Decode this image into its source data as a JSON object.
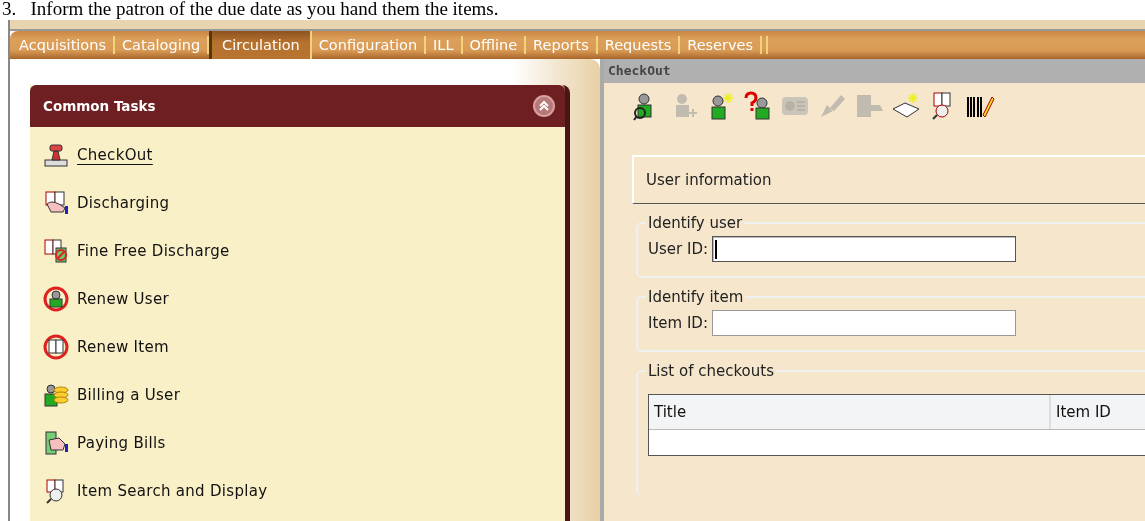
{
  "document_text": "3.   Inform the patron of the due date as you hand them the items.",
  "tabs": [
    {
      "label": "Acquisitions",
      "selected": false
    },
    {
      "label": "Cataloging",
      "selected": false
    },
    {
      "label": "Circulation",
      "selected": true
    },
    {
      "label": "Configuration",
      "selected": false
    },
    {
      "label": "ILL",
      "selected": false
    },
    {
      "label": "Offline",
      "selected": false
    },
    {
      "label": "Reports",
      "selected": false
    },
    {
      "label": "Requests",
      "selected": false
    },
    {
      "label": "Reserves",
      "selected": false
    }
  ],
  "sidebar": {
    "title": "Common Tasks",
    "expanded": true,
    "items": [
      {
        "label": "CheckOut",
        "selected": true
      },
      {
        "label": "Discharging",
        "selected": false
      },
      {
        "label": "Fine Free Discharge",
        "selected": false
      },
      {
        "label": "Renew User",
        "selected": false
      },
      {
        "label": "Renew Item",
        "selected": false
      },
      {
        "label": "Billing a User",
        "selected": false
      },
      {
        "label": "Paying Bills",
        "selected": false
      },
      {
        "label": "Item Search and Display",
        "selected": false
      }
    ]
  },
  "panel": {
    "title": "CheckOut",
    "toolbar": [
      {
        "disabled": false
      },
      {
        "disabled": true
      },
      {
        "disabled": false
      },
      {
        "disabled": false
      },
      {
        "disabled": true
      },
      {
        "disabled": true
      },
      {
        "disabled": true
      },
      {
        "disabled": false
      },
      {
        "disabled": false
      },
      {
        "disabled": false
      }
    ],
    "section_title": "User information",
    "fieldsets": [
      {
        "legend": "Identify user",
        "label": "User ID:",
        "focused": true
      },
      {
        "legend": "Identify item",
        "label": "Item ID:",
        "focused": false
      }
    ],
    "checkouts": {
      "legend": "List of checkouts",
      "columns": [
        "Title",
        "Item ID"
      ]
    }
  }
}
